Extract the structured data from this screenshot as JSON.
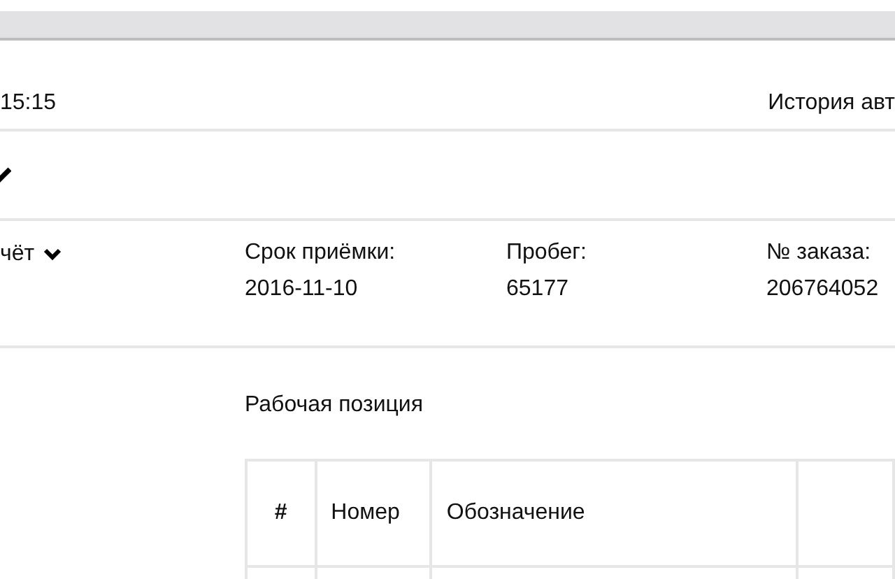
{
  "header": {
    "time": "15:15",
    "link": "История авт"
  },
  "report": {
    "label": "чёт"
  },
  "fields": [
    {
      "label": "Срок приёмки:",
      "value": "2016-11-10"
    },
    {
      "label": "Пробег:",
      "value": "65177"
    },
    {
      "label": "№ заказа:",
      "value": "206764052"
    }
  ],
  "section_title": "Рабочая позиция",
  "table": {
    "columns": [
      "#",
      "Номер",
      "Обозначение"
    ]
  }
}
